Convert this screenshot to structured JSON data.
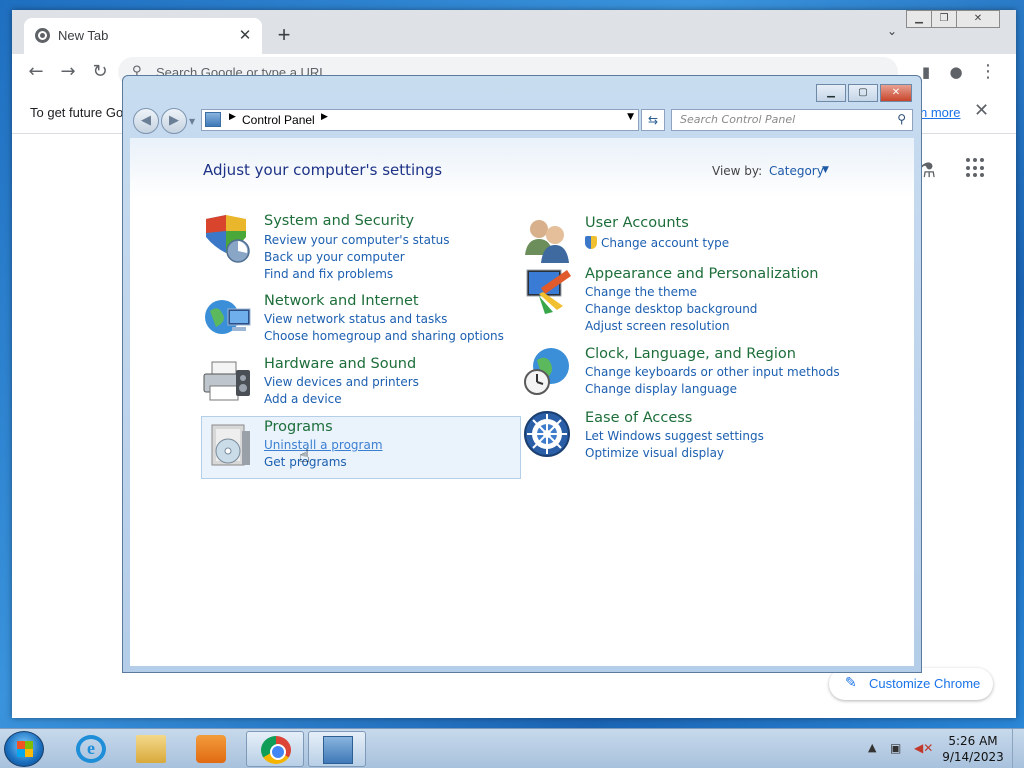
{
  "chrome": {
    "tab_title": "New Tab",
    "tab_close": "✕",
    "new_tab": "+",
    "omnibox_placeholder": "Search Google or type a URL",
    "infobar_text": "To get future Go",
    "infobar_link": "n more",
    "customize_label": "Customize Chrome"
  },
  "control_panel": {
    "address": "Control Panel",
    "search_placeholder": "Search Control Panel",
    "heading": "Adjust your computer's settings",
    "view_by_label": "View by:",
    "view_by_value": "Category",
    "categories": [
      {
        "title": "System and Security",
        "icon": "shield-icon",
        "links": [
          "Review your computer's status",
          "Back up your computer",
          "Find and fix problems"
        ]
      },
      {
        "title": "Network and Internet",
        "icon": "network-icon",
        "links": [
          "View network status and tasks",
          "Choose homegroup and sharing options"
        ]
      },
      {
        "title": "Hardware and Sound",
        "icon": "printer-icon",
        "links": [
          "View devices and printers",
          "Add a device"
        ]
      },
      {
        "title": "Programs",
        "icon": "programs-icon",
        "links": [
          "Uninstall a program",
          "Get programs"
        ]
      },
      {
        "title": "User Accounts",
        "icon": "users-icon",
        "links": [
          "Change account type"
        ]
      },
      {
        "title": "Appearance and Personalization",
        "icon": "appearance-icon",
        "links": [
          "Change the theme",
          "Change desktop background",
          "Adjust screen resolution"
        ]
      },
      {
        "title": "Clock, Language, and Region",
        "icon": "globe-clock-icon",
        "links": [
          "Change keyboards or other input methods",
          "Change display language"
        ]
      },
      {
        "title": "Ease of Access",
        "icon": "ease-of-access-icon",
        "links": [
          "Let Windows suggest settings",
          "Optimize visual display"
        ]
      }
    ]
  },
  "taskbar": {
    "time": "5:26 AM",
    "date": "9/14/2023"
  },
  "colors": {
    "link": "#1c5fb0",
    "category_title": "#1d6e3a",
    "heading": "#1e3287"
  }
}
